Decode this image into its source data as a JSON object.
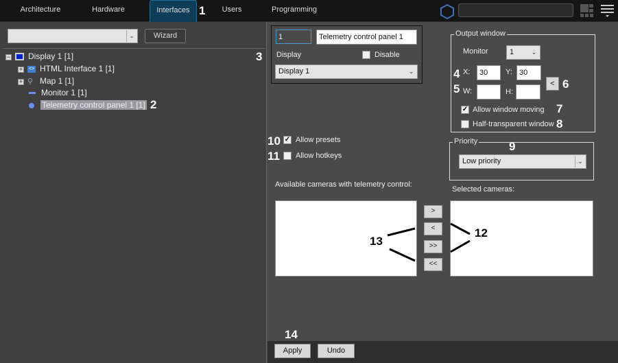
{
  "tabs": [
    {
      "label": "Architecture"
    },
    {
      "label": "Hardware"
    },
    {
      "label": "Interfaces",
      "active": true
    },
    {
      "label": "Users"
    },
    {
      "label": "Programming"
    }
  ],
  "callouts": [
    "1",
    "2",
    "3",
    "4",
    "5",
    "6",
    "7",
    "8",
    "9",
    "10",
    "11",
    "12",
    "13",
    "14"
  ],
  "left": {
    "filter_value": "",
    "wizard_label": "Wizard",
    "tree": [
      {
        "label": "Display 1 [1]"
      },
      {
        "label": "HTML Interface 1 [1]"
      },
      {
        "label": "Map 1 [1]"
      },
      {
        "label": "Monitor 1 [1]"
      },
      {
        "label": "Telemetry control panel 1 [1]",
        "selected": true
      }
    ]
  },
  "search": {
    "value": ""
  },
  "object": {
    "id": "1",
    "name": "Telemetry control panel 1",
    "display_label": "Display",
    "disable_label": "Disable",
    "disable_checked": false,
    "display_value": "Display 1"
  },
  "output": {
    "title": "Output window",
    "monitor_label": "Monitor",
    "monitor_value": "1",
    "x_label": "X:",
    "x": "30",
    "y_label": "Y:",
    "y": "30",
    "w_label": "W:",
    "w": "",
    "h_label": "H:",
    "h": "",
    "get_button": "<",
    "allow_moving_label": "Allow window moving",
    "allow_moving": true,
    "half_label": "Half-transparent window",
    "half": false
  },
  "priority": {
    "title": "Priority",
    "value": "Low priority"
  },
  "options": {
    "presets_label": "Allow presets",
    "presets": true,
    "hotkeys_label": "Allow hotkeys",
    "hotkeys": false
  },
  "cameras": {
    "available_label": "Available cameras with telemetry control:",
    "selected_label": "Selected cameras:",
    "buttons": [
      ">",
      "<",
      ">>",
      "<<"
    ]
  },
  "footer": {
    "apply": "Apply",
    "undo": "Undo"
  },
  "colors": {
    "accent": "#0e3d5a",
    "hex_icon": "#3f6fb5"
  }
}
